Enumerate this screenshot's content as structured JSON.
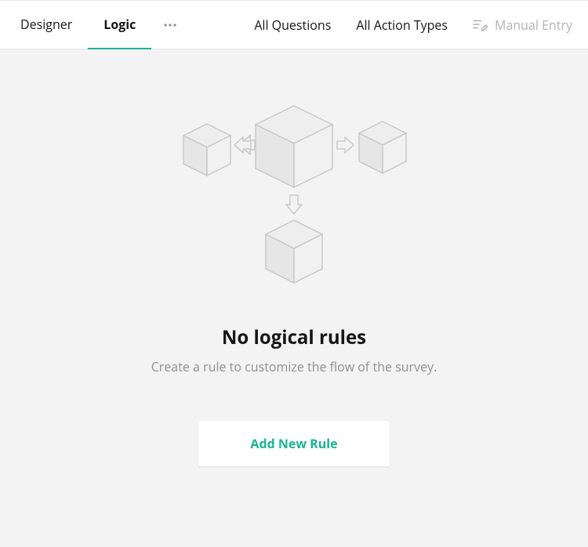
{
  "toolbar": {
    "tabs": {
      "designer": "Designer",
      "logic": "Logic"
    },
    "filters": {
      "all_questions": "All Questions",
      "all_action_types": "All Action Types"
    },
    "manual_entry": "Manual Entry"
  },
  "empty_state": {
    "title": "No logical rules",
    "description": "Create a rule to customize the flow of the survey.",
    "button_label": "Add New Rule"
  },
  "colors": {
    "accent": "#19b394",
    "muted": "#b3b3b3",
    "text_secondary": "#909090",
    "background": "#f3f3f3"
  }
}
